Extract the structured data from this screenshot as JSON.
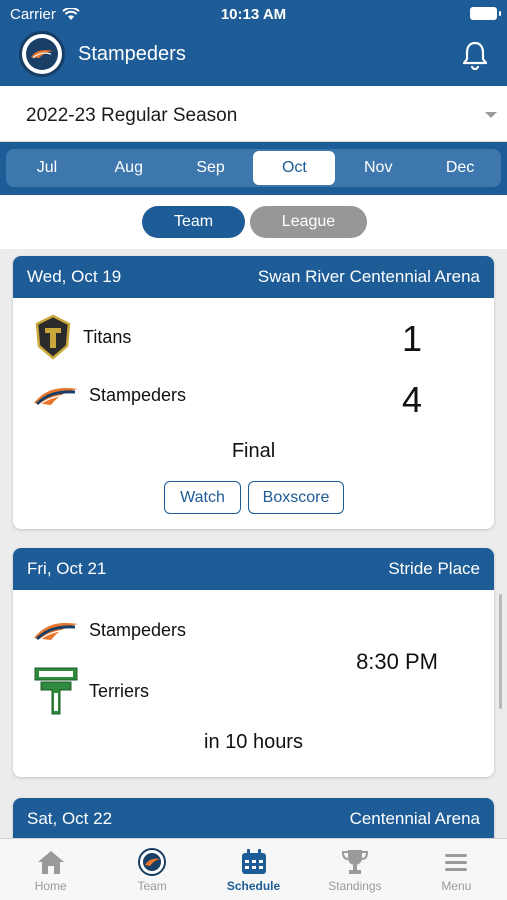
{
  "status_bar": {
    "carrier": "Carrier",
    "time": "10:13 AM"
  },
  "header": {
    "title": "Stampeders",
    "notification_icon": "bell-icon"
  },
  "season_picker": {
    "value": "2022-23 Regular Season"
  },
  "months": [
    "Jul",
    "Aug",
    "Sep",
    "Oct",
    "Nov",
    "Dec"
  ],
  "selected_month": "Oct",
  "scope_toggle": {
    "team": "Team",
    "league": "League",
    "selected": "Team"
  },
  "games": [
    {
      "date": "Wed, Oct 19",
      "venue": "Swan River Centennial Arena",
      "team1": {
        "name": "Titans",
        "score": "1"
      },
      "team2": {
        "name": "Stampeders",
        "score": "4"
      },
      "status": "Final",
      "buttons": [
        "Watch",
        "Boxscore"
      ]
    },
    {
      "date": "Fri, Oct 21",
      "venue": "Stride Place",
      "team1": {
        "name": "Stampeders"
      },
      "team2": {
        "name": "Terriers"
      },
      "time": "8:30 PM",
      "status": "in 10 hours"
    },
    {
      "date": "Sat, Oct 22",
      "venue": "Centennial Arena"
    }
  ],
  "tab_bar": [
    {
      "label": "Home",
      "icon": "home-icon"
    },
    {
      "label": "Team",
      "icon": "team-logo-icon"
    },
    {
      "label": "Schedule",
      "icon": "calendar-icon"
    },
    {
      "label": "Standings",
      "icon": "trophy-icon"
    },
    {
      "label": "Menu",
      "icon": "menu-icon"
    }
  ],
  "active_tab": "Schedule",
  "colors": {
    "primary": "#1d5c96",
    "segment": "#3d77ad",
    "inactive": "#979797"
  }
}
